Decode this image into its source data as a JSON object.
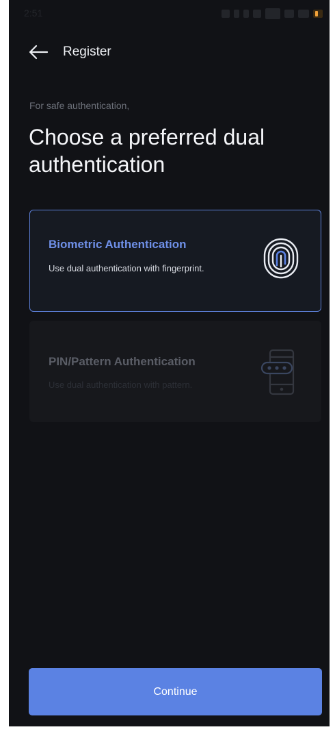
{
  "status_bar": {
    "time": "2:51"
  },
  "header": {
    "back_icon": "arrow-left-icon",
    "title": "Register"
  },
  "intro": {
    "subtitle": "For safe authentication,",
    "heading": "Choose a preferred dual authentication"
  },
  "options": [
    {
      "title": "Biometric Authentication",
      "description": "Use dual authentication with fingerprint.",
      "icon": "fingerprint-icon",
      "selected": true
    },
    {
      "title": "PIN/Pattern Authentication",
      "description": "Use dual authentication with pattern.",
      "icon": "phone-pin-icon",
      "selected": false
    }
  ],
  "actions": {
    "continue_label": "Continue"
  },
  "colors": {
    "background": "#111216",
    "accent": "#5b82e3",
    "selected_border": "#5d80d8",
    "selected_title": "#6f90e8"
  }
}
